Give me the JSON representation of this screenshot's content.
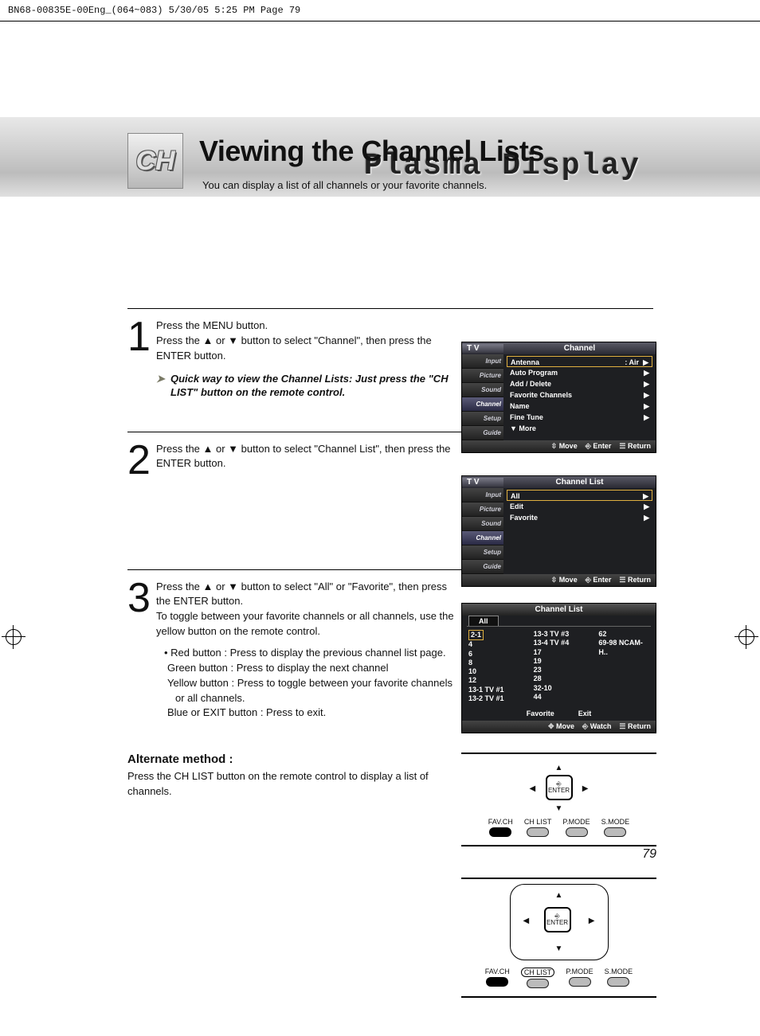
{
  "printmark": "BN68-00835E-00Eng_(064~083)  5/30/05  5:25 PM  Page 79",
  "banner_title": "Plasma Display",
  "ch_badge": "CH",
  "page_title": "Viewing the Channel Lists",
  "page_sub": "You can display a list of all channels or your favorite channels.",
  "step1": {
    "num": "1",
    "l1": "Press the MENU button.",
    "l2": "Press the ▲ or ▼ button to select \"Channel\", then press the ENTER button.",
    "tip": "Quick way to view the Channel Lists: Just press the \"CH LIST\" button on the remote control."
  },
  "step2": {
    "num": "2",
    "l1": "Press the ▲ or ▼ button to select \"Channel List\", then press the ENTER button."
  },
  "step3": {
    "num": "3",
    "l1": "Press the ▲ or ▼ button to select \"All\" or \"Favorite\", then press the ENTER button.",
    "l2": "To toggle between your favorite channels or all channels, use the yellow button on the remote control.",
    "b1": "• Red button : Press to display the previous channel list page.",
    "b2": "Green button : Press to display the next channel",
    "b3": "Yellow button : Press to toggle between your favorite channels or all channels.",
    "b4": "Blue or EXIT button : Press to exit."
  },
  "alt_head": "Alternate method :",
  "alt_body": "Press the CH LIST button on the remote control to display a list of channels.",
  "page_num": "79",
  "osd1": {
    "tv": "T V",
    "title": "Channel",
    "side": [
      "Input",
      "Picture",
      "Sound",
      "Channel",
      "Setup",
      "Guide"
    ],
    "rows": [
      {
        "l": "Antenna",
        "r": ": Air",
        "arrow": "▶"
      },
      {
        "l": "Auto Program",
        "r": "",
        "arrow": "▶"
      },
      {
        "l": "Add / Delete",
        "r": "",
        "arrow": "▶"
      },
      {
        "l": "Favorite Channels",
        "r": "",
        "arrow": "▶"
      },
      {
        "l": "Name",
        "r": "",
        "arrow": "▶"
      },
      {
        "l": "Fine Tune",
        "r": "",
        "arrow": "▶"
      },
      {
        "l": "▼ More",
        "r": "",
        "arrow": ""
      }
    ],
    "footer": {
      "a": "Move",
      "b": "Enter",
      "c": "Return"
    }
  },
  "osd2": {
    "tv": "T V",
    "title": "Channel List",
    "side": [
      "Input",
      "Picture",
      "Sound",
      "Channel",
      "Setup",
      "Guide"
    ],
    "rows": [
      {
        "l": "All",
        "r": "",
        "arrow": "▶"
      },
      {
        "l": "Edit",
        "r": "",
        "arrow": "▶"
      },
      {
        "l": "Favorite",
        "r": "",
        "arrow": "▶"
      }
    ],
    "footer": {
      "a": "Move",
      "b": "Enter",
      "c": "Return"
    }
  },
  "osd3": {
    "title": "Channel List",
    "tab": "All",
    "col1": [
      "2-1",
      "4",
      "6",
      "8",
      "10",
      "12",
      "13-1 TV #1",
      "13-2 TV #1"
    ],
    "col2": [
      "13-3 TV #3",
      "13-4 TV #4",
      "17",
      "19",
      "23",
      "28",
      "32-10",
      "44"
    ],
    "col3": [
      "62",
      "69-98 NCAM-H.."
    ],
    "labels": {
      "a": "Favorite",
      "b": "Exit"
    },
    "footer": {
      "a": "Move",
      "b": "Watch",
      "c": "Return"
    }
  },
  "remote": {
    "enter_icon": "⎆",
    "enter": "ENTER",
    "b1": "FAV.CH",
    "b2": "CH LIST",
    "b3": "P.MODE",
    "b4": "S.MODE"
  }
}
